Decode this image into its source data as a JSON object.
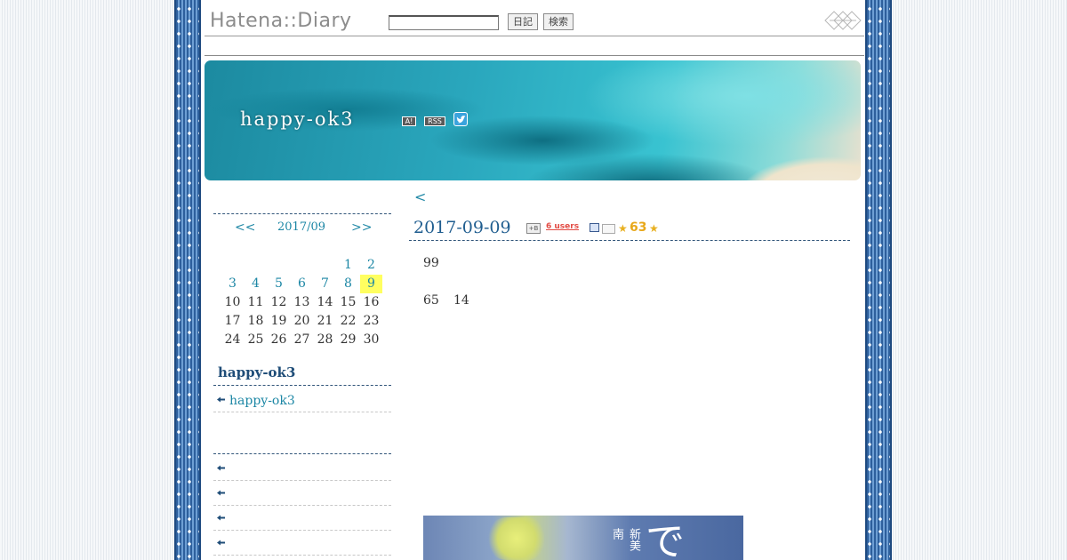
{
  "header": {
    "logo": "Hatena::Diary",
    "search_placeholder": "",
    "diary_button": "日記",
    "search_button": "検索"
  },
  "banner": {
    "title": "happy-ok3",
    "antenna_label": "A!",
    "rss_label": "RSS"
  },
  "calendar": {
    "prev": "<<",
    "month": "2017/09",
    "next": ">>",
    "weeks": [
      [
        "",
        "",
        "",
        "",
        "",
        "1",
        "2"
      ],
      [
        "3",
        "4",
        "5",
        "6",
        "7",
        "8",
        "9"
      ],
      [
        "10",
        "11",
        "12",
        "13",
        "14",
        "15",
        "16"
      ],
      [
        "17",
        "18",
        "19",
        "20",
        "21",
        "22",
        "23"
      ],
      [
        "24",
        "25",
        "26",
        "27",
        "28",
        "29",
        "30"
      ]
    ],
    "today": "9"
  },
  "sidebar": {
    "section_title": "happy-ok3",
    "profile_link": "happy-ok3"
  },
  "entry": {
    "prev_link": "<",
    "date": "2017-09-09",
    "bookmark_icon_label": "+B",
    "users_badge": "6 users",
    "star_count": "63",
    "star_glyph": "★",
    "line1": "99",
    "line2a": "65",
    "line2b": "14",
    "photo_char": "で",
    "photo_small_text": "新美南"
  },
  "colors": {
    "link": "#1d87a5",
    "stripe": "#3f78b8",
    "today_highlight": "#ffff60",
    "star": "#e8a81a"
  }
}
